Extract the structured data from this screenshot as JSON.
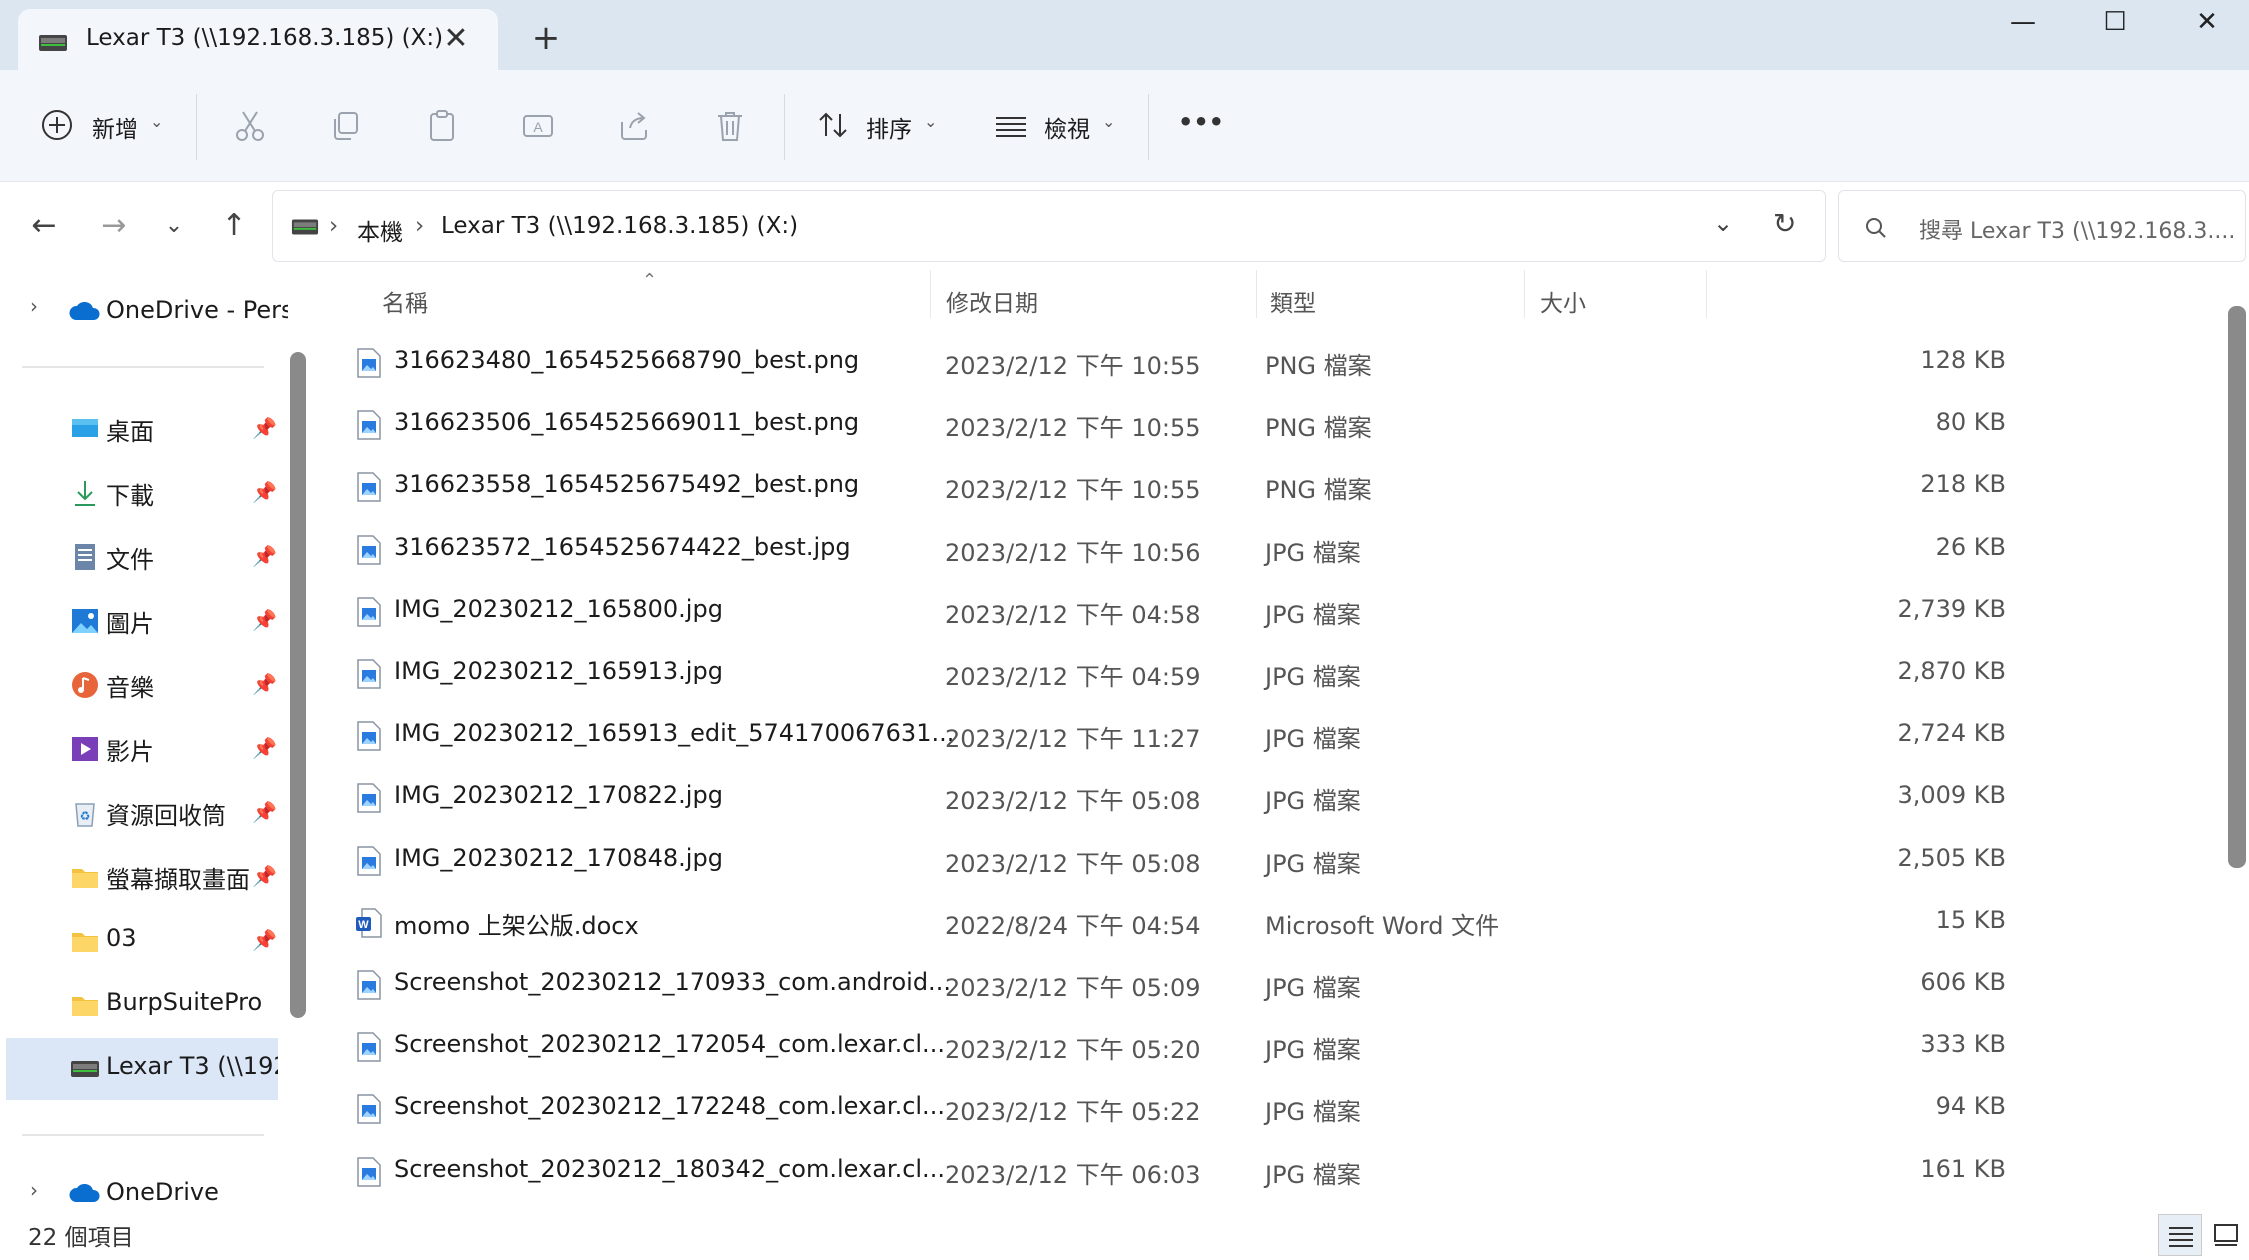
{
  "window": {
    "tab_title": "Lexar T3 (\\\\192.168.3.185) (X:)",
    "minimize_glyph": "—",
    "maximize_glyph": "☐",
    "close_glyph": "✕"
  },
  "toolbar": {
    "new_label": "新增",
    "sort_label": "排序",
    "view_label": "檢視",
    "more_label": "•••"
  },
  "address": {
    "crumbs": [
      "本機",
      "Lexar T3 (\\\\192.168.3.185) (X:)"
    ],
    "search_placeholder": "搜尋 Lexar T3 (\\\\192.168.3...."
  },
  "sidebar": {
    "onedrive_personal": "OneDrive - Pers",
    "items": [
      {
        "label": "桌面",
        "icon": "desktop-icon",
        "pinned": true
      },
      {
        "label": "下載",
        "icon": "download-icon",
        "pinned": true
      },
      {
        "label": "文件",
        "icon": "documents-icon",
        "pinned": true
      },
      {
        "label": "圖片",
        "icon": "pictures-icon",
        "pinned": true
      },
      {
        "label": "音樂",
        "icon": "music-icon",
        "pinned": true
      },
      {
        "label": "影片",
        "icon": "videos-icon",
        "pinned": true
      },
      {
        "label": "資源回收筒",
        "icon": "recycle-bin-icon",
        "pinned": true
      },
      {
        "label": "螢幕擷取畫面",
        "icon": "folder-icon",
        "pinned": true
      },
      {
        "label": "03",
        "icon": "folder-icon",
        "pinned": true
      },
      {
        "label": "BurpSuitePro",
        "icon": "folder-icon",
        "pinned": false
      },
      {
        "label": "Lexar T3 (\\\\192.",
        "icon": "drive-icon",
        "pinned": false,
        "selected": true
      }
    ],
    "onedrive": "OneDrive"
  },
  "columns": {
    "name": "名稱",
    "date": "修改日期",
    "type": "類型",
    "size": "大小"
  },
  "files": [
    {
      "name": "316623480_1654525668790_best.png",
      "date": "2023/2/12 下午 10:55",
      "type": "PNG 檔案",
      "size": "128 KB",
      "kind": "image"
    },
    {
      "name": "316623506_1654525669011_best.png",
      "date": "2023/2/12 下午 10:55",
      "type": "PNG 檔案",
      "size": "80 KB",
      "kind": "image"
    },
    {
      "name": "316623558_1654525675492_best.png",
      "date": "2023/2/12 下午 10:55",
      "type": "PNG 檔案",
      "size": "218 KB",
      "kind": "image"
    },
    {
      "name": "316623572_1654525674422_best.jpg",
      "date": "2023/2/12 下午 10:56",
      "type": "JPG 檔案",
      "size": "26 KB",
      "kind": "image"
    },
    {
      "name": "IMG_20230212_165800.jpg",
      "date": "2023/2/12 下午 04:58",
      "type": "JPG 檔案",
      "size": "2,739 KB",
      "kind": "image"
    },
    {
      "name": "IMG_20230212_165913.jpg",
      "date": "2023/2/12 下午 04:59",
      "type": "JPG 檔案",
      "size": "2,870 KB",
      "kind": "image"
    },
    {
      "name": "IMG_20230212_165913_edit_574170067631...",
      "date": "2023/2/12 下午 11:27",
      "type": "JPG 檔案",
      "size": "2,724 KB",
      "kind": "image"
    },
    {
      "name": "IMG_20230212_170822.jpg",
      "date": "2023/2/12 下午 05:08",
      "type": "JPG 檔案",
      "size": "3,009 KB",
      "kind": "image"
    },
    {
      "name": "IMG_20230212_170848.jpg",
      "date": "2023/2/12 下午 05:08",
      "type": "JPG 檔案",
      "size": "2,505 KB",
      "kind": "image"
    },
    {
      "name": "momo 上架公版.docx",
      "date": "2022/8/24 下午 04:54",
      "type": "Microsoft Word 文件",
      "size": "15 KB",
      "kind": "word"
    },
    {
      "name": "Screenshot_20230212_170933_com.android...",
      "date": "2023/2/12 下午 05:09",
      "type": "JPG 檔案",
      "size": "606 KB",
      "kind": "image"
    },
    {
      "name": "Screenshot_20230212_172054_com.lexar.cl...",
      "date": "2023/2/12 下午 05:20",
      "type": "JPG 檔案",
      "size": "333 KB",
      "kind": "image"
    },
    {
      "name": "Screenshot_20230212_172248_com.lexar.cl...",
      "date": "2023/2/12 下午 05:22",
      "type": "JPG 檔案",
      "size": "94 KB",
      "kind": "image"
    },
    {
      "name": "Screenshot_20230212_180342_com.lexar.cl...",
      "date": "2023/2/12 下午 06:03",
      "type": "JPG 檔案",
      "size": "161 KB",
      "kind": "image"
    }
  ],
  "status": {
    "count": "22 個項目"
  }
}
